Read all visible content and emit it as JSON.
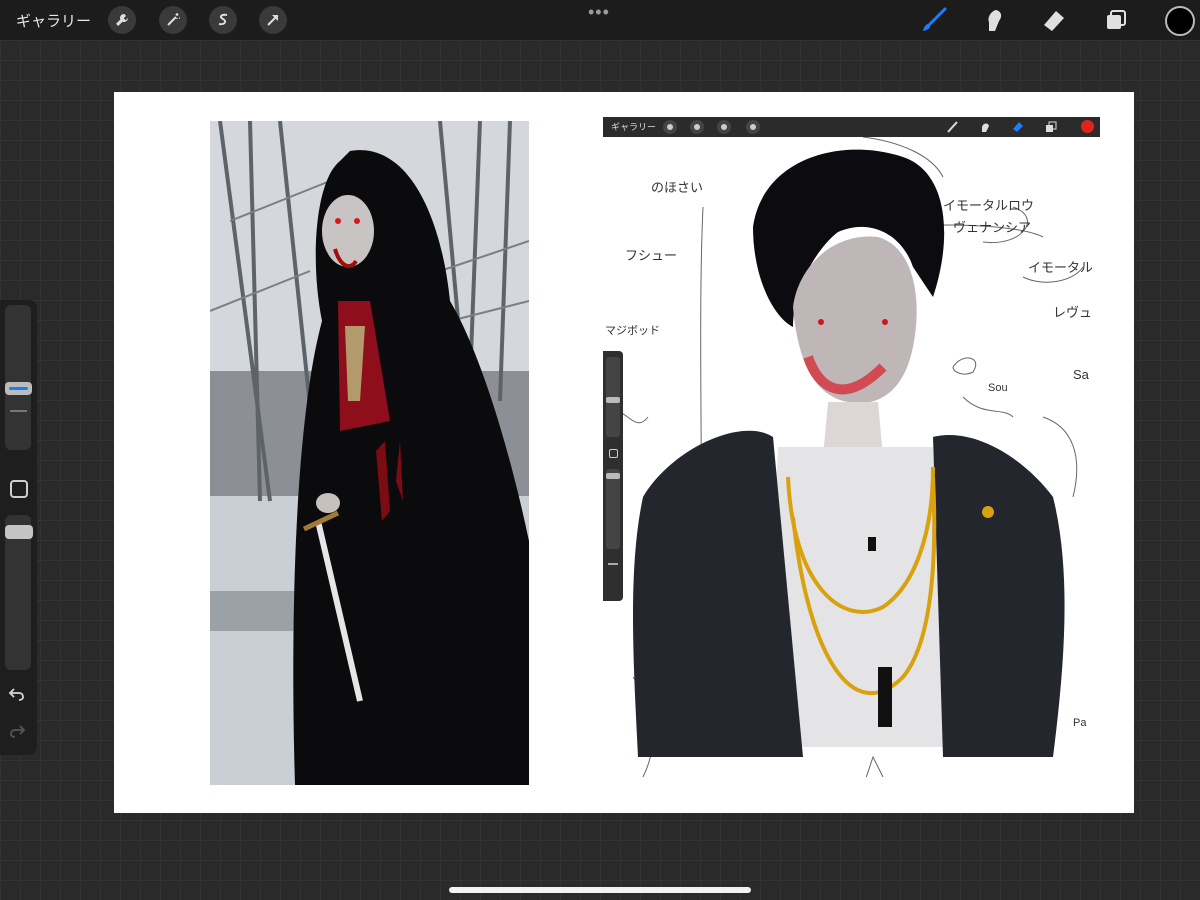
{
  "topbar": {
    "gallery_label": "ギャラリー",
    "more_label": "•••",
    "actions": [
      "wrench-icon",
      "magic-wand-icon",
      "selection-icon",
      "transform-arrow-icon"
    ],
    "tools": [
      "brush-icon",
      "smudge-icon",
      "eraser-icon",
      "layers-icon"
    ],
    "active_tool": "brush-icon",
    "accent": "#1a7cff",
    "current_color": "#000000"
  },
  "sidebar": {
    "controls": [
      "brush-size-slider",
      "modify-button",
      "opacity-slider",
      "undo-icon",
      "redo-icon"
    ]
  },
  "embedded_screenshot": {
    "gallery_label": "ギャラリー",
    "active_tool": "eraser-icon",
    "current_color": "#e0231c",
    "sketch_notes": [
      "のほさい",
      "フシュー",
      "マジボッド",
      "イモータルロウ",
      "ヴェナンシア",
      "イモータル",
      "レヴュ",
      "Sou",
      "Sa",
      "Pa"
    ]
  }
}
